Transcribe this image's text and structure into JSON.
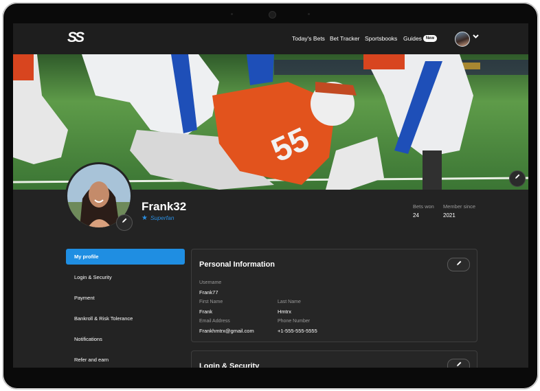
{
  "brand": {
    "logo": "SS"
  },
  "nav": {
    "links": [
      "Today's Bets",
      "Bet Tracker",
      "Sportsbooks",
      "Guides"
    ],
    "new_badge": "New"
  },
  "profile": {
    "username": "Frank32",
    "tier": "Superfan",
    "stats": [
      {
        "label": "Bets won",
        "value": "24"
      },
      {
        "label": "Member since",
        "value": "2021"
      }
    ]
  },
  "sidebar": {
    "items": [
      {
        "label": "My profile",
        "active": true
      },
      {
        "label": "Login & Security",
        "active": false
      },
      {
        "label": "Payment",
        "active": false
      },
      {
        "label": "Bankroll & Risk Tolerance",
        "active": false
      },
      {
        "label": "Notifications",
        "active": false
      },
      {
        "label": "Refer and earn",
        "active": false
      }
    ]
  },
  "personal_info": {
    "title": "Personal Information",
    "fields": {
      "username": {
        "label": "Username",
        "value": "Frank77"
      },
      "first_name": {
        "label": "First Name",
        "value": "Frank"
      },
      "last_name": {
        "label": "Last Name",
        "value": "Hmtrx"
      },
      "email": {
        "label": "Email Address",
        "value": "Frankhmtrx@gmail.com"
      },
      "phone": {
        "label": "Phone Number",
        "value": "+1-555-555-5555"
      }
    }
  },
  "login_security": {
    "title": "Login & Security"
  },
  "colors": {
    "accent": "#1f8ee2",
    "background": "#232323",
    "nav": "#1e1e1e"
  },
  "icons": [
    "pencil-icon",
    "star-icon",
    "chevron-down-icon"
  ]
}
